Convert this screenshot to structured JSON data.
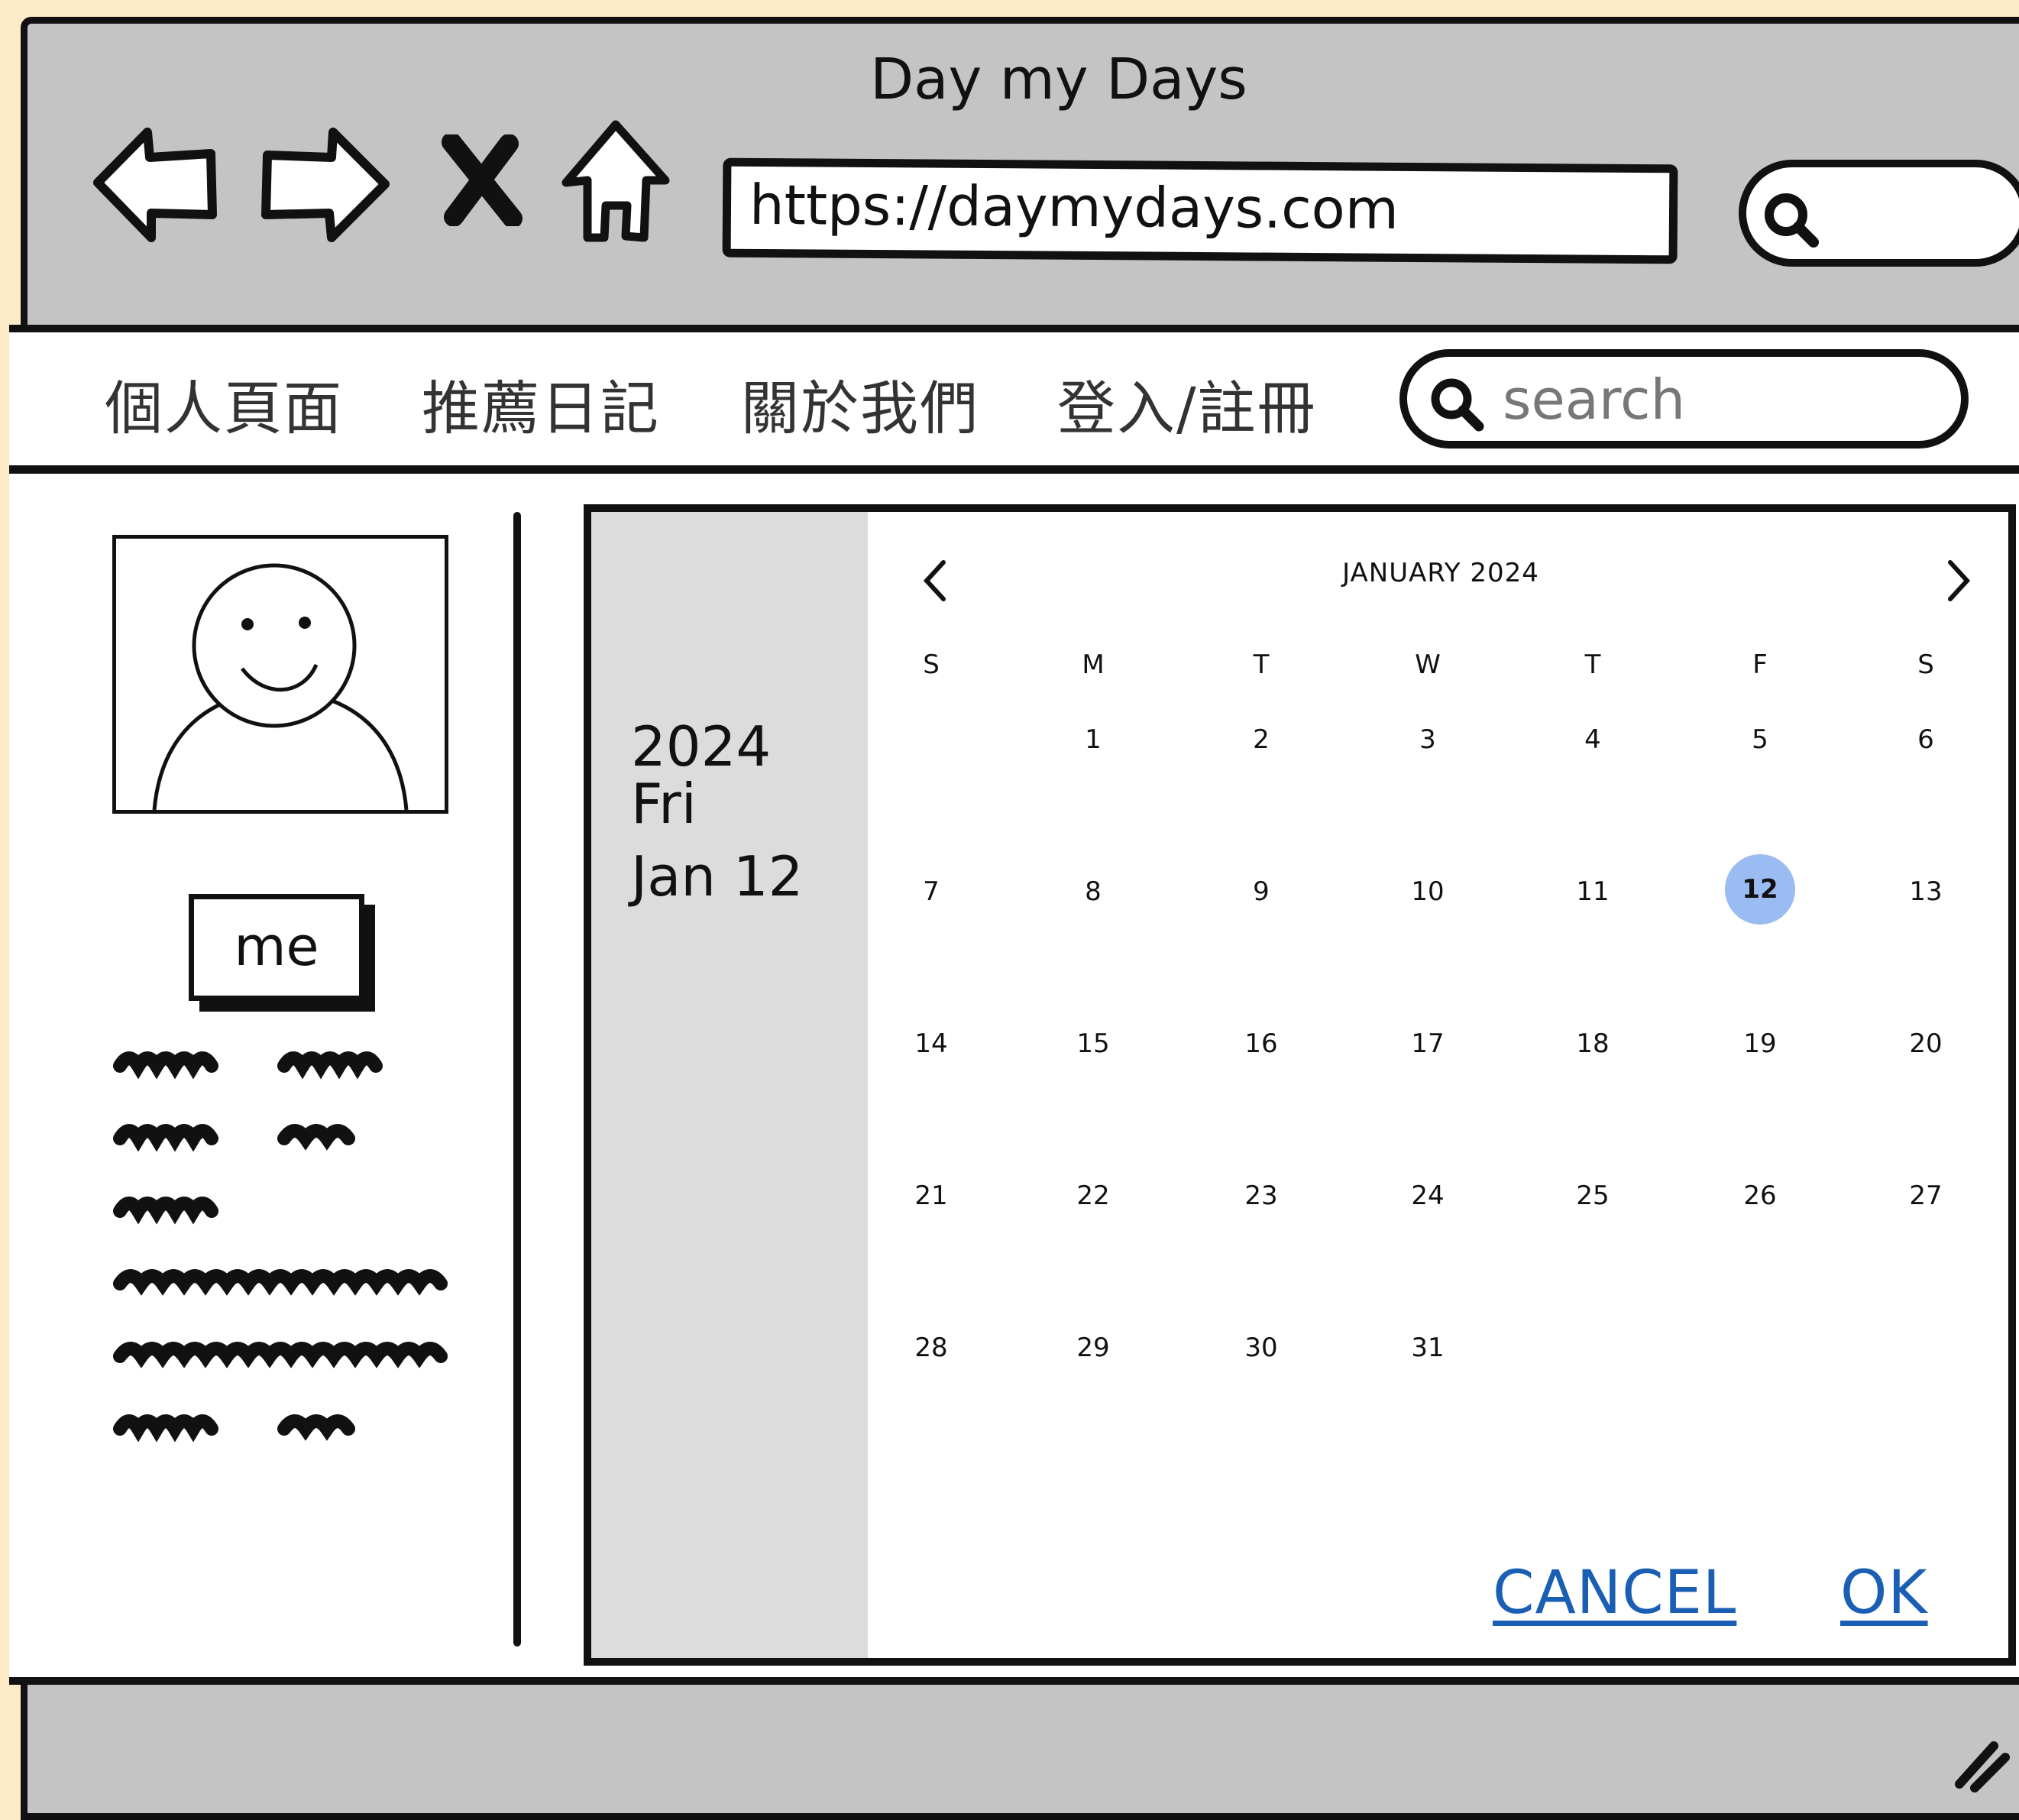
{
  "window": {
    "title": "Day my Days"
  },
  "browser": {
    "url": "https://daymydays.com",
    "icons": [
      "back-arrow-icon",
      "forward-arrow-icon",
      "close-x-icon",
      "home-icon",
      "search-icon"
    ]
  },
  "nav": {
    "items": [
      {
        "label": "個人頁面"
      },
      {
        "label": "推薦日記"
      },
      {
        "label": "關於我們"
      },
      {
        "label": "登入/註冊"
      }
    ],
    "search_placeholder": "search"
  },
  "profile": {
    "name_button": "me"
  },
  "date_picker": {
    "selected_year": "2024",
    "selected_weekday": "Fri",
    "selected_date": "Jan 12",
    "month_label": "JANUARY 2024",
    "weekdays": [
      "S",
      "M",
      "T",
      "W",
      "T",
      "F",
      "S"
    ],
    "days": [
      [
        "",
        "1",
        "2",
        "3",
        "4",
        "5",
        "6"
      ],
      [
        "7",
        "8",
        "9",
        "10",
        "11",
        "12",
        "13"
      ],
      [
        "14",
        "15",
        "16",
        "17",
        "18",
        "19",
        "20"
      ],
      [
        "21",
        "22",
        "23",
        "24",
        "25",
        "26",
        "27"
      ],
      [
        "28",
        "29",
        "30",
        "31",
        "",
        "",
        ""
      ]
    ],
    "selected_day": "12",
    "selected_color": "#9bbcf2",
    "cancel_label": "CANCEL",
    "ok_label": "OK",
    "action_color": "#1b5fb4"
  }
}
